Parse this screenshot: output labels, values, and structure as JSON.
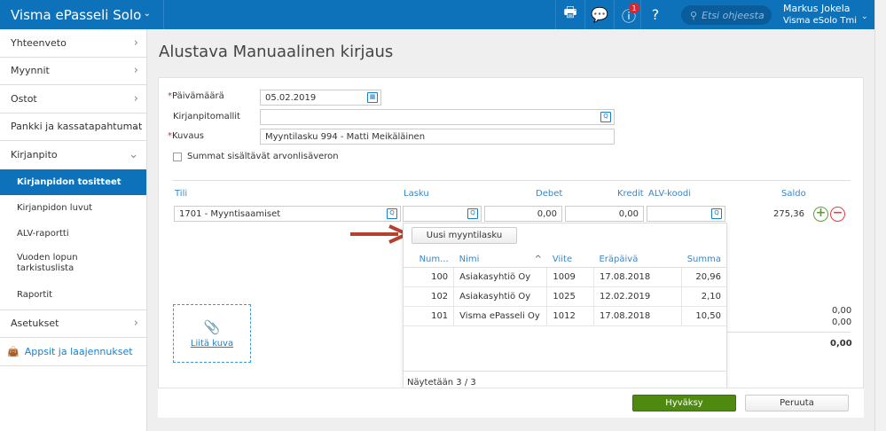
{
  "app": {
    "title": "Visma ePasseli Solo",
    "search_placeholder": "Etsi ohjeesta",
    "notification_count": "1",
    "user_name": "Markus Jokela",
    "user_org": "Visma eSolo Tmi"
  },
  "sidebar": {
    "items": [
      {
        "label": "Yhteenveto"
      },
      {
        "label": "Myynnit"
      },
      {
        "label": "Ostot"
      },
      {
        "label": "Pankki ja kassatapahtumat"
      },
      {
        "label": "Kirjanpito"
      }
    ],
    "sub_items": [
      {
        "label": "Kirjanpidon tositteet",
        "active": true
      },
      {
        "label": "Kirjanpidon luvut"
      },
      {
        "label": "ALV-raportti"
      },
      {
        "label": "Vuoden lopun tarkistuslista"
      },
      {
        "label": "Raportit"
      }
    ],
    "settings": "Asetukset",
    "apps": "Appsit ja laajennukset"
  },
  "page": {
    "title": "Alustava Manuaalinen kirjaus"
  },
  "form": {
    "date_label": "Päivämäärä",
    "date_value": "05.02.2019",
    "template_label": "Kirjanpitomallit",
    "template_value": "",
    "desc_label": "Kuvaus",
    "desc_value": "Myyntilasku 994 - Matti Meikäläinen",
    "vat_checkbox": "Summat sisältävät arvonlisäveron",
    "required_mark": "*"
  },
  "rows": {
    "headers": {
      "account": "Tili",
      "invoice": "Lasku",
      "debit": "Debet",
      "credit": "Kredit",
      "vat": "ALV-koodi",
      "balance": "Saldo"
    },
    "account": "1701 - Myyntisaamiset",
    "invoice": "",
    "debit": "0,00",
    "credit": "0,00",
    "vat": "",
    "balance": "275,36"
  },
  "totals": {
    "debit_total": "0,00",
    "credit_total": "0,00",
    "difference": "0,00"
  },
  "attach": {
    "label": "Liitä kuva"
  },
  "dropdown": {
    "new_invoice": "Uusi myyntilasku",
    "columns": [
      "Num...",
      "Nimi",
      "Viite",
      "Eräpäivä",
      "Summa"
    ],
    "rows": [
      [
        "100",
        "Asiakasyhtiö Oy",
        "1009",
        "17.08.2018",
        "20,96"
      ],
      [
        "102",
        "Asiakasyhtiö Oy",
        "1025",
        "12.02.2019",
        "2,10"
      ],
      [
        "101",
        "Visma ePasseli Oy",
        "1012",
        "17.08.2018",
        "10,50"
      ]
    ],
    "footer": "Näytetään 3 / 3"
  },
  "actions": {
    "approve": "Hyväksy",
    "cancel": "Peruuta"
  },
  "colors": {
    "brand": "#0e72bb",
    "approve": "#4f8a10",
    "arrow": "#c0392b"
  }
}
